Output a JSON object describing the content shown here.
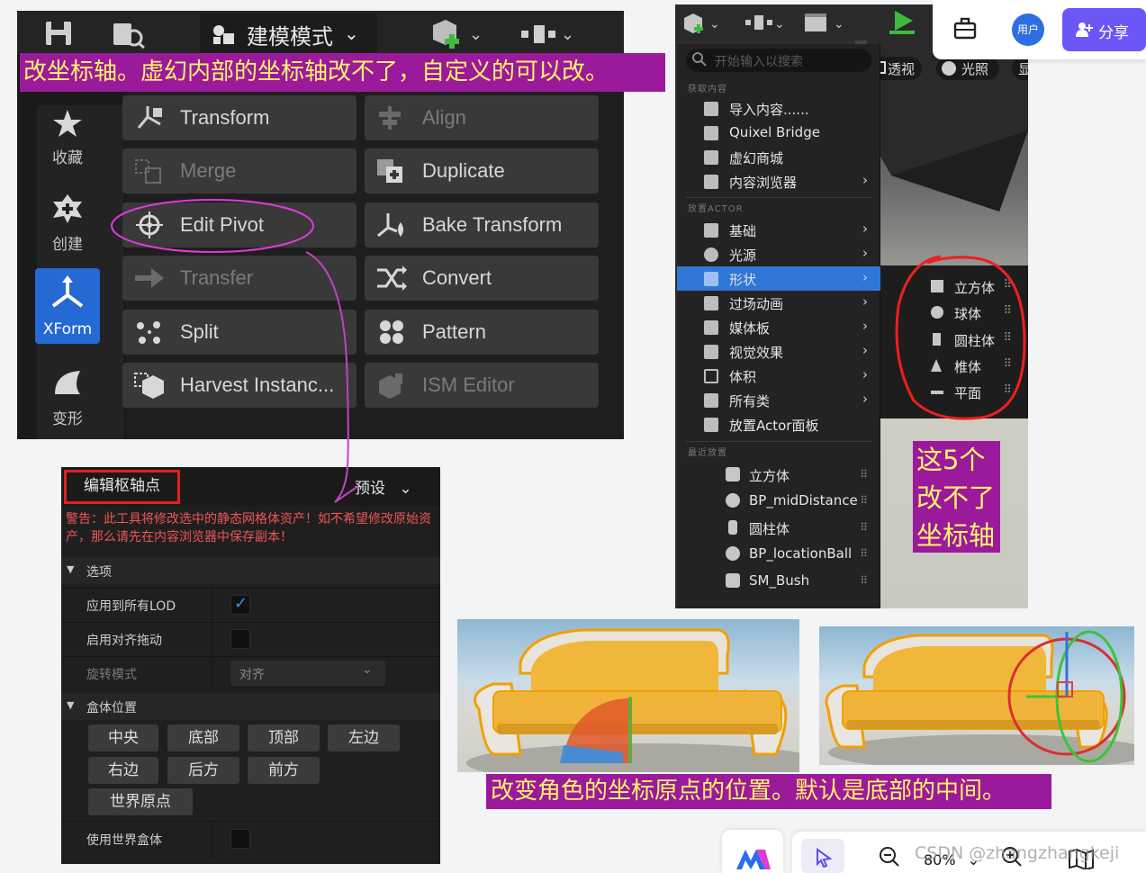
{
  "annotations": {
    "top_banner": "改坐标轴。虚幻内部的坐标轴改不了，自定义的可以改。",
    "right_note": "这5个改不了坐标轴",
    "bottom_banner": "改变角色的坐标原点的位置。默认是底部的中间。"
  },
  "modeling_panel": {
    "mode_label": "建模模式",
    "sidebar": [
      {
        "label": "收藏",
        "icon": "star-icon"
      },
      {
        "label": "创建",
        "icon": "create-icon"
      },
      {
        "label": "XForm",
        "icon": "xform-icon",
        "active": true
      },
      {
        "label": "变形",
        "icon": "deform-icon"
      }
    ],
    "tools": [
      {
        "label": "Transform",
        "icon": "transform-icon",
        "enabled": true
      },
      {
        "label": "Align",
        "icon": "align-icon",
        "enabled": false
      },
      {
        "label": "Merge",
        "icon": "merge-icon",
        "enabled": false
      },
      {
        "label": "Duplicate",
        "icon": "duplicate-icon",
        "enabled": true
      },
      {
        "label": "Edit Pivot",
        "icon": "pivot-icon",
        "enabled": true
      },
      {
        "label": "Bake Transform",
        "icon": "bake-transform-icon",
        "enabled": true
      },
      {
        "label": "Transfer",
        "icon": "transfer-icon",
        "enabled": false
      },
      {
        "label": "Convert",
        "icon": "convert-icon",
        "enabled": true
      },
      {
        "label": "Split",
        "icon": "split-icon",
        "enabled": true
      },
      {
        "label": "Pattern",
        "icon": "pattern-icon",
        "enabled": true
      },
      {
        "label": "Harvest Instanc...",
        "icon": "harvest-icon",
        "enabled": true
      },
      {
        "label": "ISM Editor",
        "icon": "ism-icon",
        "enabled": false
      }
    ]
  },
  "pivot_panel": {
    "title": "编辑枢轴点",
    "preset": "预设",
    "warning": "警告：此工具将修改选中的静态网格体资产！如不希望修改原始资产，那么请先在内容浏览器中保存副本！",
    "options_header": "选项",
    "apply_all_lod": "应用到所有LOD",
    "apply_all_lod_checked": true,
    "snap_drag": "启用对齐拖动",
    "snap_drag_checked": false,
    "rotation_mode": "旋转模式",
    "rotation_value": "对齐",
    "box_header": "盒体位置",
    "box_buttons_row1": [
      "中央",
      "底部",
      "顶部",
      "左边"
    ],
    "box_buttons_row2": [
      "右边",
      "后方",
      "前方"
    ],
    "box_buttons_row3": [
      "世界原点"
    ],
    "use_world_box": "使用世界盒体",
    "use_world_box_checked": false
  },
  "place_menu": {
    "viewport_perspective": "透视",
    "viewport_lit": "光照",
    "viewport_show": "显",
    "search_placeholder": "开始输入以搜索",
    "section_get": "获取内容",
    "get_items": [
      "导入内容......",
      "Quixel Bridge",
      "虚幻商城",
      "内容浏览器"
    ],
    "section_place": "放置ACTOR",
    "place_items": [
      "基础",
      "光源",
      "形状",
      "过场动画",
      "媒体板",
      "视觉效果",
      "体积",
      "所有类",
      "放置Actor面板"
    ],
    "selected_item": "形状",
    "section_recent": "最近放置",
    "recent_items": [
      "立方体",
      "BP_midDistance",
      "圆柱体",
      "BP_locationBall",
      "SM_Bush"
    ],
    "shape_submenu": [
      "立方体",
      "球体",
      "圆柱体",
      "椎体",
      "平面"
    ]
  },
  "toolbar": {
    "user_label": "用户",
    "share_label": "分享",
    "share_color": "#6b57f5",
    "zoom_level": "80%",
    "watermark": "CSDN @zhangzhangkeji"
  }
}
